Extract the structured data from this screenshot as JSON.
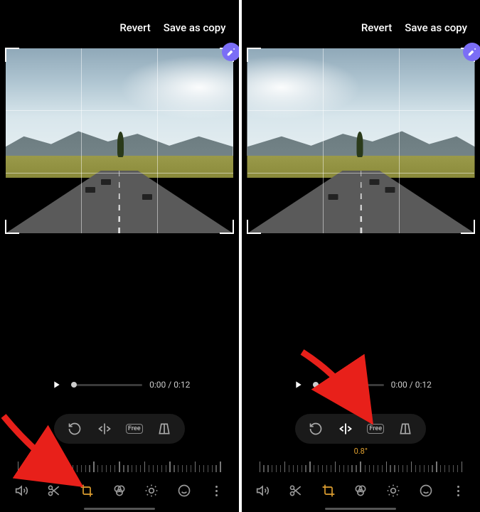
{
  "header": {
    "revert": "Revert",
    "save": "Save as copy"
  },
  "playback": {
    "time": "0:00 / 0:12"
  },
  "transform": {
    "free_label": "Free",
    "angle": "0.8°"
  },
  "icons": {
    "rotate": "rotate-icon",
    "flip": "flip-horizontal-icon",
    "ratio": "aspect-free-icon",
    "perspective": "perspective-icon",
    "volume": "volume-icon",
    "trim": "trim-icon",
    "crop": "crop-icon",
    "filter": "filter-icon",
    "adjust": "brightness-icon",
    "sticker": "emoji-icon",
    "more": "more-icon",
    "play": "play-icon",
    "edit_badge": "magic-edit-icon"
  }
}
